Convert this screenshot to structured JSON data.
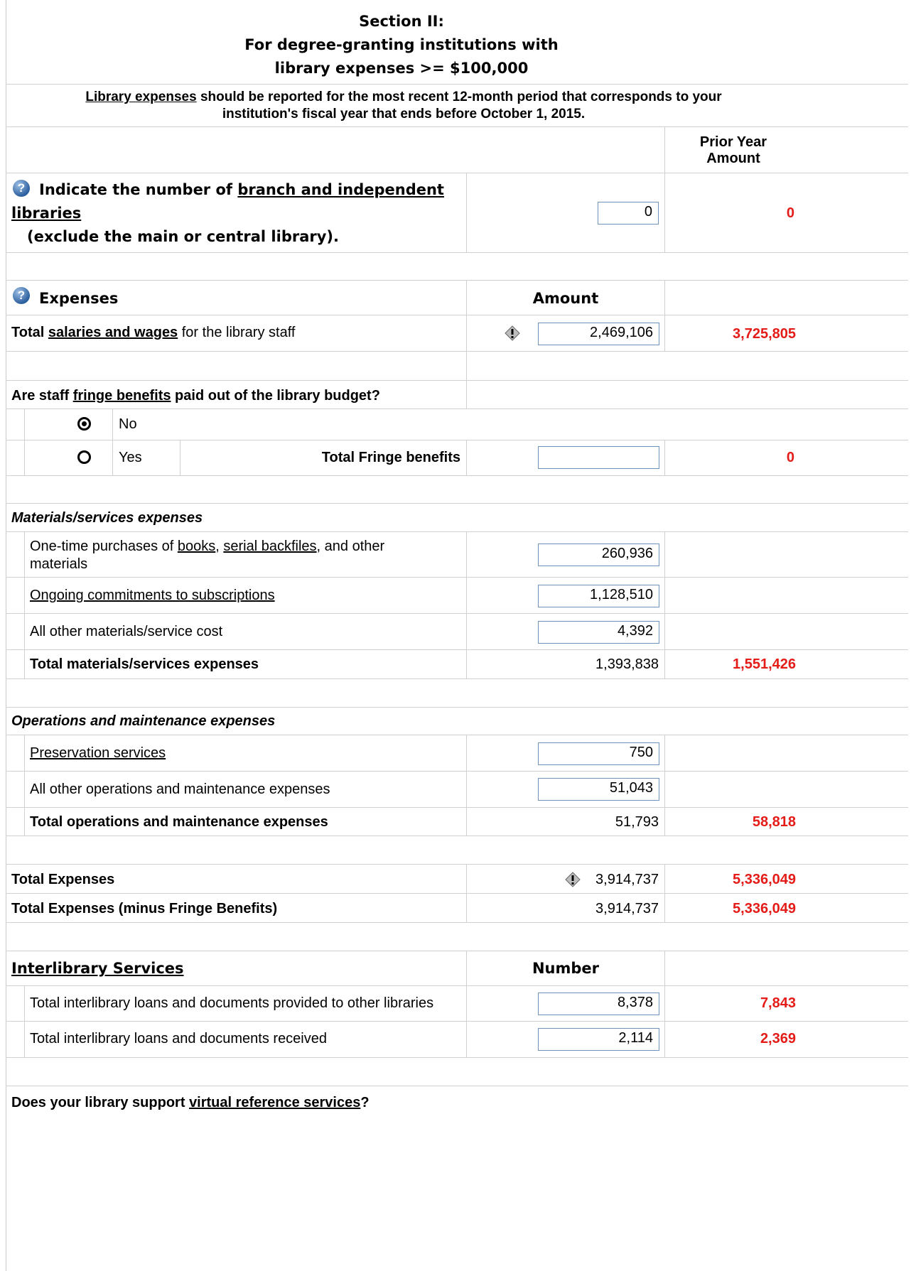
{
  "section": {
    "title_line1": "Section II:",
    "title_line2": "For degree-granting institutions with",
    "title_line3": "library expenses >= $100,000"
  },
  "intro": {
    "link": "Library expenses",
    "text1": " should be reported for the most recent 12-month period that corresponds to your",
    "text2": "institution's fiscal year that ends before October 1, 2015."
  },
  "col_headers": {
    "prior_year_line1": "Prior Year",
    "prior_year_line2": "Amount",
    "amount": "Amount",
    "number": "Number"
  },
  "branches": {
    "text_pre": "Indicate the number of ",
    "link1": "branch and independent",
    "link2": "libraries",
    "text_post": "(exclude the main or central library).",
    "value": "0",
    "prior": "0"
  },
  "expenses": {
    "label": "Expenses",
    "salaries": {
      "pre": "Total ",
      "link": "salaries and wages",
      "post": " for the library staff",
      "value": "2,469,106",
      "prior": "3,725,805"
    }
  },
  "fringe": {
    "question_pre": "Are staff ",
    "question_link": "fringe benefits",
    "question_post": " paid out of the library budget?",
    "opt_no": "No",
    "opt_yes": "Yes",
    "selected": "No",
    "total_label": "Total Fringe benefits",
    "value": "",
    "prior": "0"
  },
  "materials": {
    "heading": "Materials/services expenses",
    "onetime": {
      "pre": "One-time purchases of ",
      "link1": "books",
      "sep": ", ",
      "link2": "serial backfiles",
      "post": ", and other",
      "line2": "materials",
      "value": "260,936"
    },
    "ongoing": {
      "link": "Ongoing commitments to subscriptions",
      "value": "1,128,510"
    },
    "other": {
      "label": "All other materials/service cost",
      "value": "4,392"
    },
    "total": {
      "label": "Total materials/services expenses",
      "value": "1,393,838",
      "prior": "1,551,426"
    }
  },
  "operations": {
    "heading": "Operations and maintenance expenses",
    "preservation": {
      "link": "Preservation services",
      "value": "750"
    },
    "other": {
      "label": "All other operations and maintenance expenses",
      "value": "51,043"
    },
    "total": {
      "label": "Total operations and maintenance expenses",
      "value": "51,793",
      "prior": "58,818"
    }
  },
  "totals": {
    "total": {
      "label": "Total Expenses",
      "value": "3,914,737",
      "prior": "5,336,049"
    },
    "minus_fringe": {
      "label": "Total Expenses (minus Fringe Benefits)",
      "value": "3,914,737",
      "prior": "5,336,049"
    }
  },
  "interlibrary": {
    "heading": "Interlibrary Services",
    "provided": {
      "label": "Total interlibrary loans and documents provided to other libraries",
      "value": "8,378",
      "prior": "7,843"
    },
    "received": {
      "label": "Total interlibrary loans and documents received",
      "value": "2,114",
      "prior": "2,369"
    }
  },
  "virtual": {
    "pre": "Does your library support ",
    "link": "virtual reference services",
    "post": "?"
  },
  "icons": {
    "help": "help-icon",
    "warning": "warning-icon",
    "radio_on": "radio-selected-icon",
    "radio_off": "radio-unselected-icon"
  },
  "colors": {
    "prior_year": "#e41b17",
    "input_border": "#6f93b8"
  }
}
